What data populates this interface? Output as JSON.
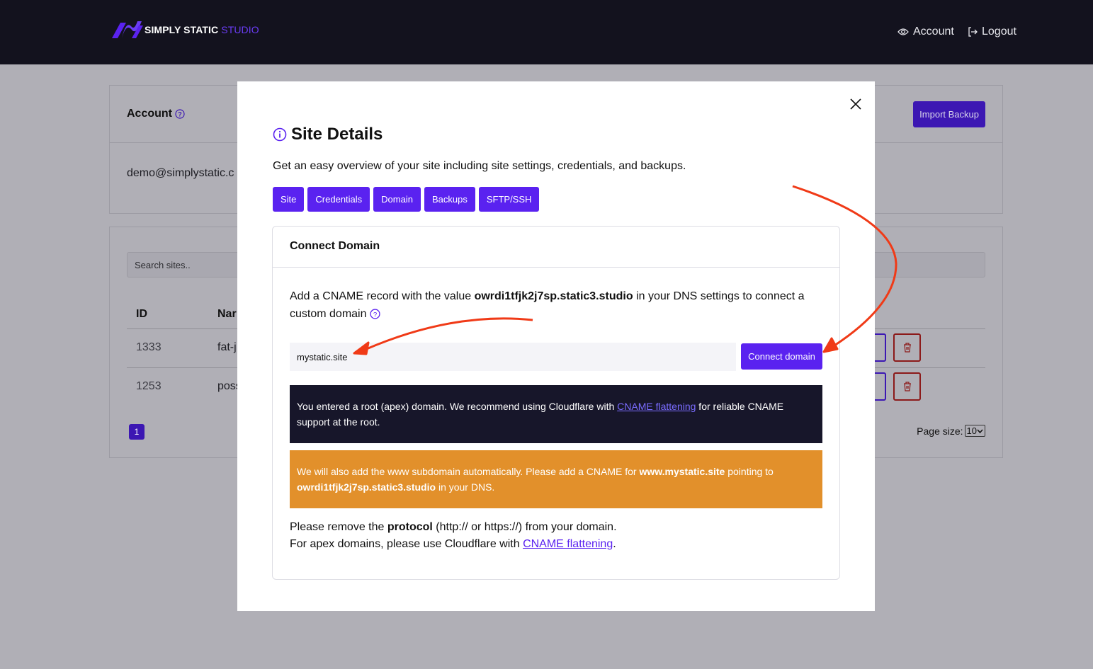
{
  "header": {
    "brand_main": "SIMPLY STATIC",
    "brand_accent": "STUDIO",
    "account_label": "Account",
    "logout_label": "Logout"
  },
  "account_card": {
    "title": "Account",
    "email": "demo@simplystatic.c",
    "import_label": "Import Backup"
  },
  "sites_card": {
    "search_placeholder": "Search sites..",
    "columns": [
      "ID",
      "Nar"
    ],
    "rows": [
      {
        "id": "1333",
        "name": "fat-j"
      },
      {
        "id": "1253",
        "name": "poss"
      }
    ],
    "page": "1",
    "page_size_label": "Page size:",
    "page_size_value": "10"
  },
  "modal": {
    "title": "Site Details",
    "description": "Get an easy overview of your site including site settings, credentials, and backups.",
    "tabs": [
      "Site",
      "Credentials",
      "Domain",
      "Backups",
      "SFTP/SSH"
    ],
    "panel": {
      "title": "Connect Domain",
      "text_before": "Add a CNAME record with the value ",
      "cname_value": "owrdi1tfjk2j7sp.static3.studio",
      "text_after": " in your DNS settings to connect a custom domain",
      "domain_value": "mystatic.site",
      "connect_label": "Connect domain",
      "notice_dark_before": "You entered a root (apex) domain. We recommend using Cloudflare with ",
      "notice_dark_link": "CNAME flattening",
      "notice_dark_after": " for reliable CNAME support at the root.",
      "notice_orange_1": "We will also add the www subdomain automatically. Please add a CNAME for ",
      "notice_orange_www": "www.mystatic.site",
      "notice_orange_2": " pointing to ",
      "notice_orange_target": "owrdi1tfjk2j7sp.static3.studio",
      "notice_orange_3": " in your DNS.",
      "foot_1a": "Please remove the ",
      "foot_1b": "protocol",
      "foot_1c": " (http:// or https://) from your domain.",
      "foot_2a": "For apex domains, please use Cloudflare with ",
      "foot_2b": "CNAME flattening",
      "foot_2c": "."
    }
  },
  "colors": {
    "brand": "#5a22f0",
    "nav_bg": "#13121e",
    "notice_dark": "#17162a",
    "notice_orange": "#e2902b",
    "annotation_arrow": "#f03a17"
  },
  "icons": [
    "logo-icon",
    "eye-icon",
    "logout-icon",
    "help-icon",
    "info-icon",
    "close-icon",
    "trash-icon"
  ]
}
